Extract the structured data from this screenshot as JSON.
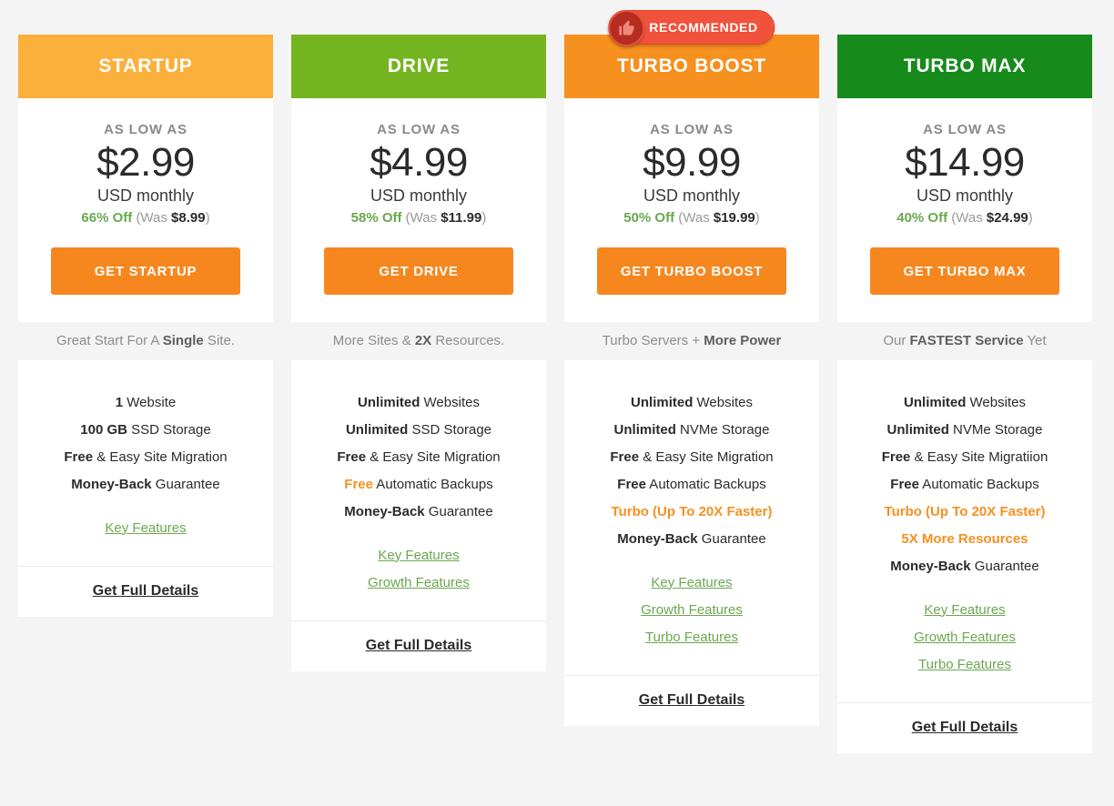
{
  "page": {
    "background_color": "#f4f4f4",
    "accent_orange": "#f6871f",
    "link_green": "#6aa84f",
    "badge_red": "#f0523c"
  },
  "badge": {
    "label": "RECOMMENDED",
    "icon": "thumbs-up-icon",
    "on_plan": "TURBO BOOST"
  },
  "common": {
    "as_low_as": "AS LOW AS",
    "period": "USD monthly",
    "was_prefix": "(Was ",
    "was_suffix": ")",
    "details_label": "Get Full Details"
  },
  "plans": [
    {
      "name": "STARTUP",
      "header_color": "#fbb03b",
      "as_low_as": "AS LOW AS",
      "price": "$2.99",
      "period": "USD monthly",
      "discount_pct": "66% Off",
      "was_prefix": "(Was ",
      "was_price": "$8.99",
      "was_suffix": ")",
      "cta_label": "GET STARTUP",
      "tagline_pre": "Great Start For A ",
      "tagline_bold": "Single",
      "tagline_post": " Site.",
      "features": [
        {
          "bold": "1",
          "rest": " Website",
          "highlight": false
        },
        {
          "bold": "100 GB",
          "rest": " SSD Storage",
          "highlight": false
        },
        {
          "bold": "Free",
          "rest": " & Easy Site Migration",
          "highlight": false
        },
        {
          "bold": "Money-Back",
          "rest": " Guarantee",
          "highlight": false
        }
      ],
      "links": [
        "Key Features"
      ],
      "details_label": "Get Full Details"
    },
    {
      "name": "DRIVE",
      "header_color": "#74b421",
      "as_low_as": "AS LOW AS",
      "price": "$4.99",
      "period": "USD monthly",
      "discount_pct": "58% Off",
      "was_prefix": "(Was ",
      "was_price": "$11.99",
      "was_suffix": ")",
      "cta_label": "GET DRIVE",
      "tagline_pre": "More Sites & ",
      "tagline_bold": "2X",
      "tagline_post": " Resources.",
      "features": [
        {
          "bold": "Unlimited",
          "rest": " Websites",
          "highlight": false
        },
        {
          "bold": "Unlimited",
          "rest": " SSD Storage",
          "highlight": false
        },
        {
          "bold": "Free",
          "rest": " & Easy Site Migration",
          "highlight": false
        },
        {
          "bold": "Free",
          "rest": " Automatic Backups",
          "highlight": "partial"
        },
        {
          "bold": "Money-Back",
          "rest": " Guarantee",
          "highlight": false
        }
      ],
      "links": [
        "Key Features",
        "Growth Features"
      ],
      "details_label": "Get Full Details"
    },
    {
      "name": "TURBO BOOST",
      "header_color": "#f6901f",
      "as_low_as": "AS LOW AS",
      "price": "$9.99",
      "period": "USD monthly",
      "discount_pct": "50% Off",
      "was_prefix": "(Was ",
      "was_price": "$19.99",
      "was_suffix": ")",
      "cta_label": "GET TURBO BOOST",
      "tagline_pre": "Turbo Servers + ",
      "tagline_bold": "More Power",
      "tagline_post": "",
      "features": [
        {
          "bold": "Unlimited",
          "rest": " Websites",
          "highlight": false
        },
        {
          "bold": "Unlimited",
          "rest": " NVMe Storage",
          "highlight": false
        },
        {
          "bold": "Free",
          "rest": " & Easy Site Migration",
          "highlight": false
        },
        {
          "bold": "Free",
          "rest": " Automatic Backups",
          "highlight": false
        },
        {
          "bold": "Turbo (Up To 20X Faster)",
          "rest": "",
          "highlight": true
        },
        {
          "bold": "Money-Back",
          "rest": " Guarantee",
          "highlight": false
        }
      ],
      "links": [
        "Key Features",
        "Growth Features",
        "Turbo Features"
      ],
      "details_label": "Get Full Details"
    },
    {
      "name": "TURBO MAX",
      "header_color": "#178a1c",
      "as_low_as": "AS LOW AS",
      "price": "$14.99",
      "period": "USD monthly",
      "discount_pct": "40% Off",
      "was_prefix": "(Was ",
      "was_price": "$24.99",
      "was_suffix": ")",
      "cta_label": "GET TURBO MAX",
      "tagline_pre": "Our ",
      "tagline_bold": "FASTEST Service",
      "tagline_post": " Yet",
      "features": [
        {
          "bold": "Unlimited",
          "rest": " Websites",
          "highlight": false
        },
        {
          "bold": "Unlimited",
          "rest": " NVMe Storage",
          "highlight": false
        },
        {
          "bold": "Free",
          "rest": " & Easy Site Migratiion",
          "highlight": false
        },
        {
          "bold": "Free",
          "rest": " Automatic Backups",
          "highlight": false
        },
        {
          "bold": "Turbo (Up To 20X Faster)",
          "rest": "",
          "highlight": true
        },
        {
          "bold": "5X More Resources",
          "rest": "",
          "highlight": true
        },
        {
          "bold": "Money-Back",
          "rest": " Guarantee",
          "highlight": false
        }
      ],
      "links": [
        "Key Features",
        "Growth Features",
        "Turbo Features"
      ],
      "details_label": "Get Full Details"
    }
  ]
}
